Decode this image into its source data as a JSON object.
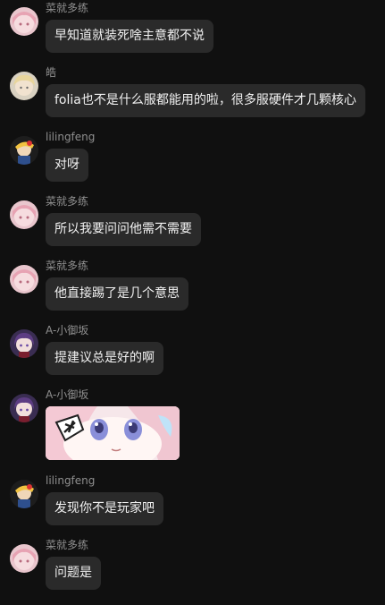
{
  "messages": [
    {
      "sender": "菜就多练",
      "text": "早知道就装死啥主意都不说",
      "avatar_icon": "pink-hair-avatar"
    },
    {
      "sender": "皓",
      "text": "folia也不是什么服都能用的啦，很多服硬件才几颗核心",
      "avatar_icon": "blonde-avatar"
    },
    {
      "sender": "lilingfeng",
      "text": "对呀",
      "avatar_icon": "anime-character-avatar"
    },
    {
      "sender": "菜就多练",
      "text": "所以我要问问他需不需要",
      "avatar_icon": "pink-hair-avatar"
    },
    {
      "sender": "菜就多练",
      "text": "他直接踢了是几个意思",
      "avatar_icon": "pink-hair-avatar"
    },
    {
      "sender": "A-小御坂",
      "text": "提建议总是好的啊",
      "avatar_icon": "purple-hair-avatar"
    },
    {
      "sender": "A-小御坂",
      "text": "",
      "avatar_icon": "purple-hair-avatar",
      "sticker": "angry-anime-girl-sticker"
    },
    {
      "sender": "lilingfeng",
      "text": "发现你不是玩家吧",
      "avatar_icon": "anime-character-avatar"
    },
    {
      "sender": "菜就多练",
      "text": "问题是",
      "avatar_icon": "pink-hair-avatar"
    }
  ],
  "colors": {
    "background": "#101010",
    "bubble": "#2a2a2a",
    "sender_name": "#8f8f8f",
    "message_text": "#f1f1f1"
  }
}
